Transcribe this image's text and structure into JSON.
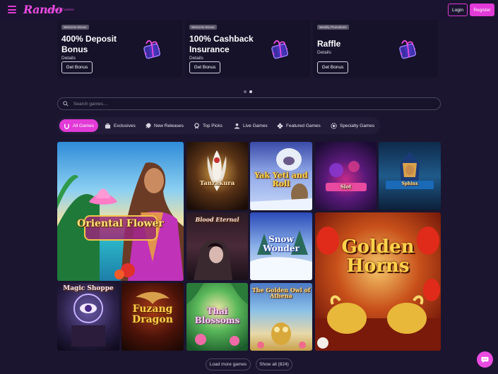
{
  "header": {
    "logo": "Rando",
    "logo_sub": "Online Casino",
    "login_label": "Login",
    "register_label": "Register"
  },
  "promos": [
    {
      "tag": "Welcome Bonus",
      "title": "400% Deposit Bonus",
      "details": "Details",
      "button": "Get Bonus"
    },
    {
      "tag": "Welcome Bonus",
      "title": "100% Cashback Insurance",
      "details": "Details",
      "button": "Get Bonus"
    },
    {
      "tag": "Weekly Promotions",
      "title": "Raffle",
      "details": "Details",
      "button": "Get Bonus"
    }
  ],
  "search": {
    "placeholder": "Search games...."
  },
  "tabs": [
    {
      "label": "All Games",
      "icon": "horseshoe-icon",
      "active": true
    },
    {
      "label": "Exclusives",
      "icon": "briefcase-icon"
    },
    {
      "label": "New Releases",
      "icon": "rocket-icon"
    },
    {
      "label": "Top Picks",
      "icon": "medal-icon"
    },
    {
      "label": "Live Games",
      "icon": "dealer-icon"
    },
    {
      "label": "Featured Games",
      "icon": "clover-icon"
    },
    {
      "label": "Specialty Games",
      "icon": "chip-icon"
    }
  ],
  "games": [
    {
      "name": "Oriental Flower"
    },
    {
      "name": "Tanzakura"
    },
    {
      "name": "Yak Yeti and Roll"
    },
    {
      "name": "Slot"
    },
    {
      "name": "Sphinx"
    },
    {
      "name": "Blood Eternal"
    },
    {
      "name": "Snow Wonder"
    },
    {
      "name": "Golden Horns"
    },
    {
      "name": "Magic Shoppe"
    },
    {
      "name": "Fuzang Dragon"
    },
    {
      "name": "Thai Blossoms"
    },
    {
      "name": "The Golden Owl of Athena"
    }
  ],
  "footer": {
    "load_more": "Load more games",
    "show_all": "Show all (824)"
  },
  "colors": {
    "accent": "#e23ad7",
    "background": "#1b1530"
  }
}
